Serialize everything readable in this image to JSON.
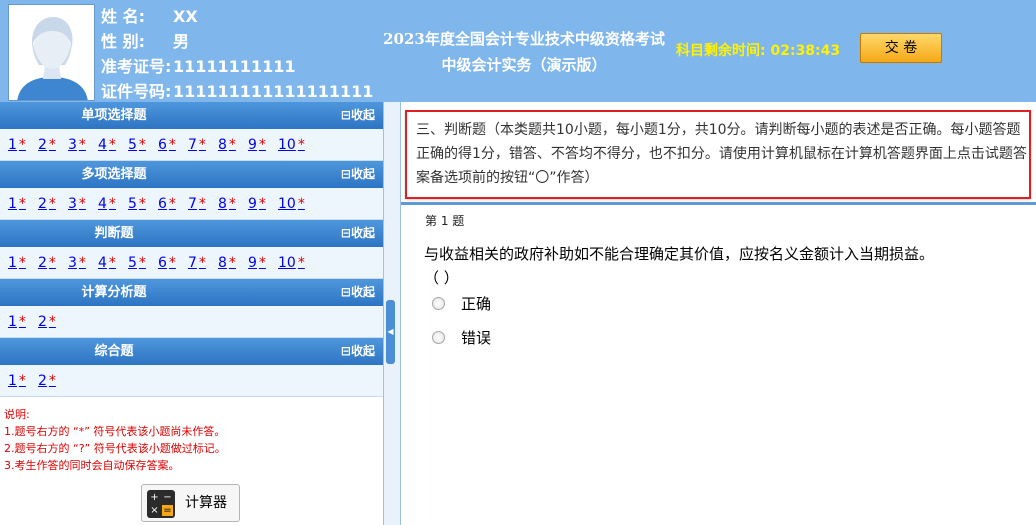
{
  "header": {
    "name_label": "姓    名:",
    "name_value": "XX",
    "gender_label": "性    别:",
    "gender_value": "男",
    "ticket_label": "准考证号:",
    "ticket_value": "11111111111",
    "id_label": "证件号码:",
    "id_value": "111111111111111111",
    "title_line1": "2023年度全国会计专业技术中级资格考试",
    "title_line2": "中级会计实务（演示版）",
    "timer_label": "科目剩余时间:",
    "timer_value": "02:38:43",
    "submit_label": "交 卷"
  },
  "colors": {
    "header_bg": "#7fb6ec",
    "section_header": "#2d74c3",
    "timer": "#fff200",
    "notes_red": "#e00000",
    "highlight_border": "#e02020"
  },
  "sections": [
    {
      "title": "单项选择题",
      "collapse": "收起",
      "questions": [
        {
          "num": "1",
          "mark": "*"
        },
        {
          "num": "2",
          "mark": "*"
        },
        {
          "num": "3",
          "mark": "*"
        },
        {
          "num": "4",
          "mark": "*"
        },
        {
          "num": "5",
          "mark": "*"
        },
        {
          "num": "6",
          "mark": "*"
        },
        {
          "num": "7",
          "mark": "*"
        },
        {
          "num": "8",
          "mark": "*"
        },
        {
          "num": "9",
          "mark": "*"
        },
        {
          "num": "10",
          "mark": "*"
        }
      ]
    },
    {
      "title": "多项选择题",
      "collapse": "收起",
      "questions": [
        {
          "num": "1",
          "mark": "*"
        },
        {
          "num": "2",
          "mark": "*"
        },
        {
          "num": "3",
          "mark": "*"
        },
        {
          "num": "4",
          "mark": "*"
        },
        {
          "num": "5",
          "mark": "*"
        },
        {
          "num": "6",
          "mark": "*"
        },
        {
          "num": "7",
          "mark": "*"
        },
        {
          "num": "8",
          "mark": "*"
        },
        {
          "num": "9",
          "mark": "*"
        },
        {
          "num": "10",
          "mark": "*"
        }
      ]
    },
    {
      "title": "判断题",
      "collapse": "收起",
      "questions": [
        {
          "num": "1",
          "mark": "*"
        },
        {
          "num": "2",
          "mark": "*"
        },
        {
          "num": "3",
          "mark": "*"
        },
        {
          "num": "4",
          "mark": "*"
        },
        {
          "num": "5",
          "mark": "*"
        },
        {
          "num": "6",
          "mark": "*"
        },
        {
          "num": "7",
          "mark": "*"
        },
        {
          "num": "8",
          "mark": "*"
        },
        {
          "num": "9",
          "mark": "*"
        },
        {
          "num": "10",
          "mark": "*"
        }
      ]
    },
    {
      "title": "计算分析题",
      "collapse": "收起",
      "questions": [
        {
          "num": "1",
          "mark": "*"
        },
        {
          "num": "2",
          "mark": "*"
        }
      ]
    },
    {
      "title": "综合题",
      "collapse": "收起",
      "questions": [
        {
          "num": "1",
          "mark": "*"
        },
        {
          "num": "2",
          "mark": "*"
        }
      ]
    }
  ],
  "notes": {
    "title": "说明:",
    "line1": "1.题号右方的 “*” 符号代表该小题尚未作答。",
    "line2": "2.题号右方的 “?” 符号代表该小题做过标记。",
    "line3": "3.考生作答的同时会自动保存答案。"
  },
  "calculator": {
    "label": "计算器",
    "icon": "calculator-icon",
    "keys": [
      "+",
      "−",
      "×",
      "="
    ]
  },
  "question": {
    "instructions": "三、判断题（本类题共10小题，每小题1分，共10分。请判断每小题的表述是否正确。每小题答题正确的得1分，错答、不答均不得分，也不扣分。请使用计算机鼠标在计算机答题界面上点击试题答案备选项前的按钮“〇”作答）",
    "number": "第 1 题",
    "text": "与收益相关的政府补助如不能合理确定其价值，应按名义金额计入当期损益。",
    "blank": "（          ）",
    "options": [
      {
        "label": "正确"
      },
      {
        "label": "错误"
      }
    ]
  }
}
